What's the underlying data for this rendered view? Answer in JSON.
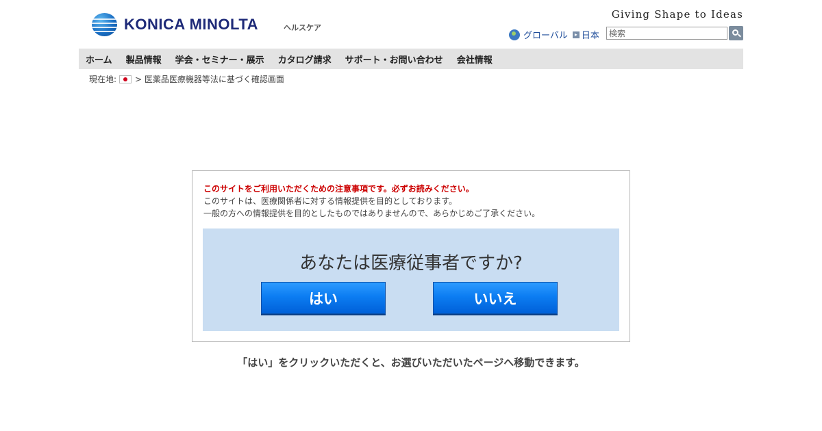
{
  "header": {
    "brand": "KONICA MINOLTA",
    "division": "ヘルスケア",
    "tagline": "Giving Shape to Ideas",
    "global_link": "グローバル",
    "country_link": "日本",
    "search_placeholder": "検索"
  },
  "nav": {
    "items": [
      {
        "label": "ホーム"
      },
      {
        "label": "製品情報"
      },
      {
        "label": "学会・セミナー・展示"
      },
      {
        "label": "カタログ請求"
      },
      {
        "label": "サポート・お問い合わせ"
      },
      {
        "label": "会社情報"
      }
    ]
  },
  "breadcrumb": {
    "prefix": "現在地:",
    "current": "> 医薬品医療機器等法に基づく確認画面"
  },
  "notice": {
    "warning": "このサイトをご利用いただくための注意事項です。必ずお読みください。",
    "line1": "このサイトは、医療関係者に対する情報提供を目的としております。",
    "line2": "一般の方への情報提供を目的としたものではありませんので、あらかじめご了承ください。",
    "question": "あなたは医療従事者ですか?",
    "yes_label": "はい",
    "no_label": "いいえ"
  },
  "footer_note": "「はい」をクリックいただくと、お選びいただいたページへ移動できます。"
}
